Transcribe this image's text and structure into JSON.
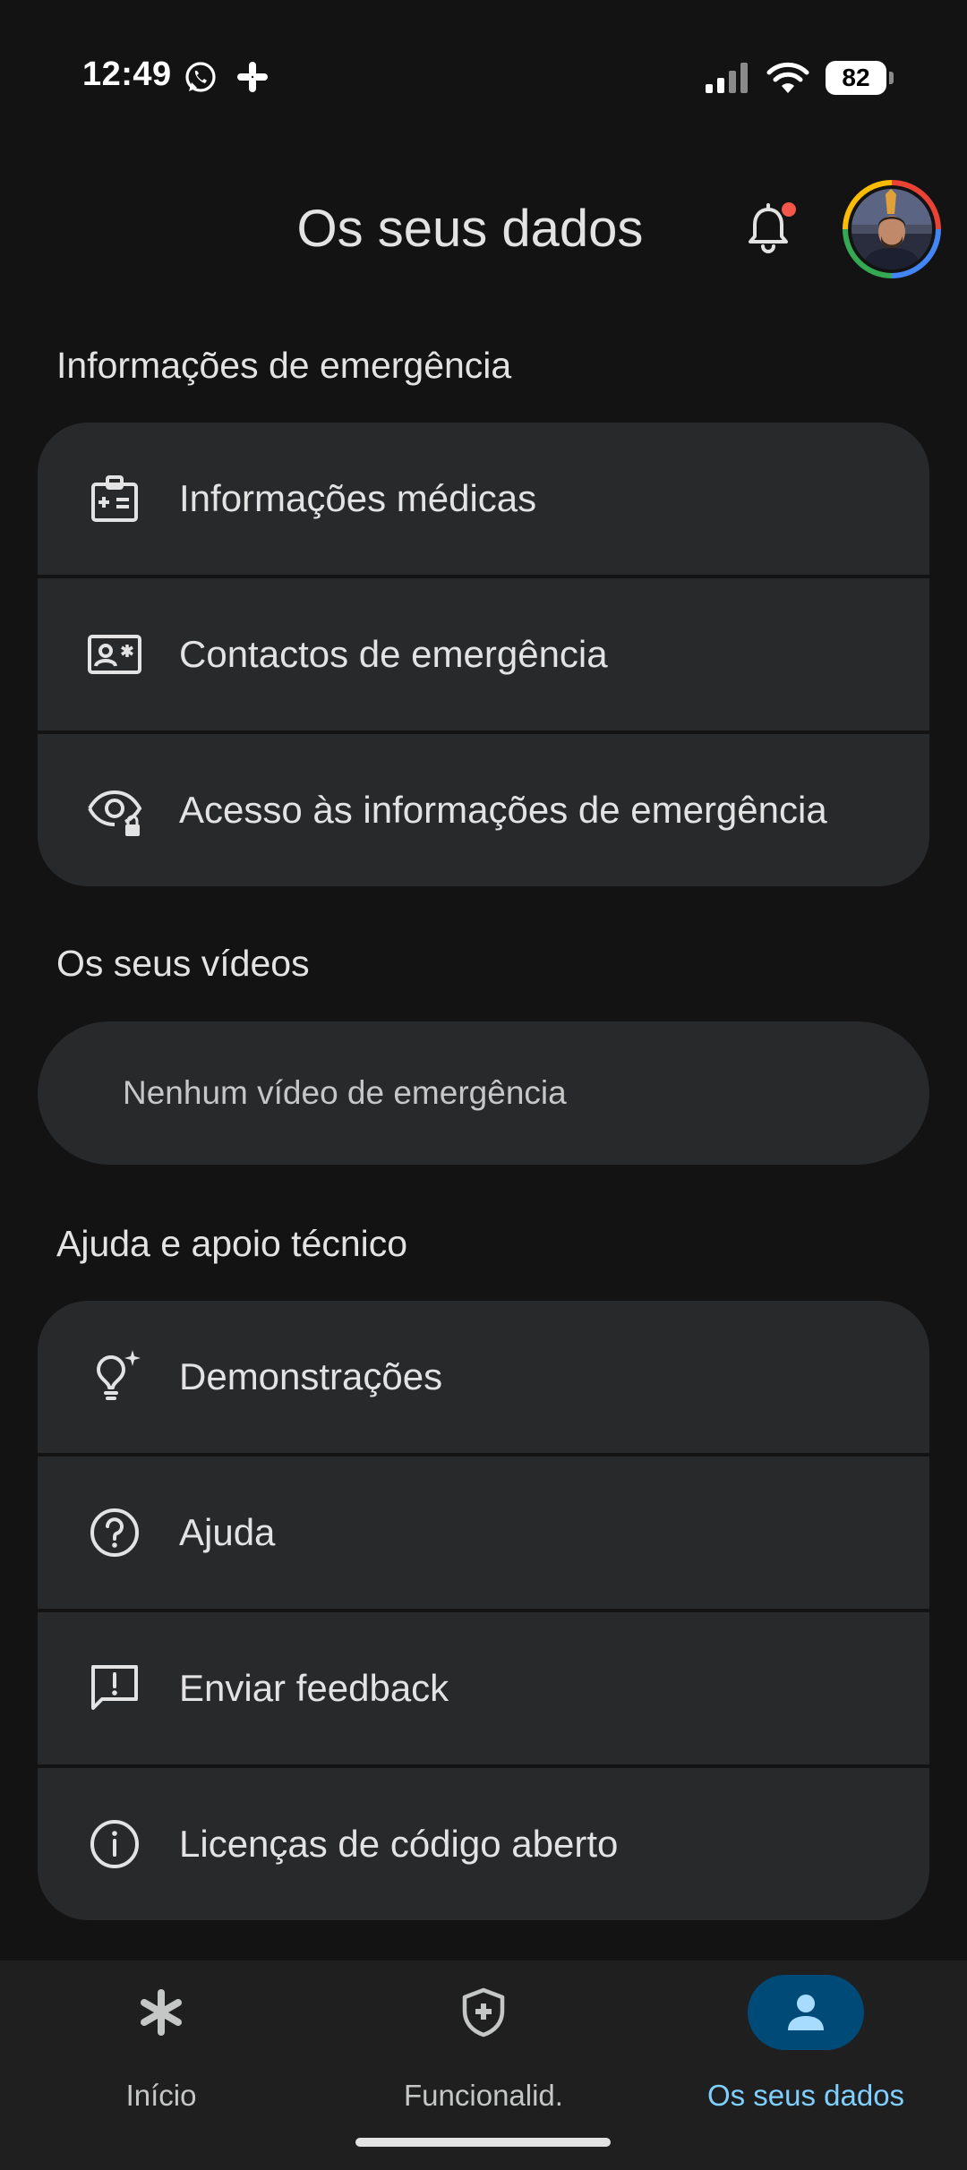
{
  "status_bar": {
    "time": "12:49",
    "battery": "82",
    "icons": [
      "whatsapp-icon",
      "slack-icon",
      "signal-icon",
      "wifi-icon",
      "battery-icon"
    ]
  },
  "header": {
    "title": "Os seus dados",
    "icons": [
      "bell-icon",
      "avatar"
    ],
    "notification_dot_color": "#f2574a"
  },
  "emergency_info": {
    "title": "Informações de emergência",
    "items": [
      {
        "label": "Informações médicas",
        "icon": "medical-id-icon"
      },
      {
        "label": "Contactos de emergência",
        "icon": "contact-card-icon"
      },
      {
        "label": "Acesso às informações de emergência",
        "icon": "eye-lock-icon"
      }
    ]
  },
  "videos": {
    "title": "Os seus vídeos",
    "empty_text": "Nenhum vídeo de emergência"
  },
  "help": {
    "title": "Ajuda e apoio técnico",
    "items": [
      {
        "label": "Demonstrações",
        "icon": "lightbulb-sparkle-icon"
      },
      {
        "label": "Ajuda",
        "icon": "help-circle-icon"
      },
      {
        "label": "Enviar feedback",
        "icon": "feedback-icon"
      },
      {
        "label": "Licenças de código aberto",
        "icon": "info-icon"
      }
    ]
  },
  "bottom_nav": {
    "items": [
      {
        "label": "Início",
        "icon": "asterisk-icon",
        "active": false
      },
      {
        "label": "Funcionalid.",
        "icon": "shield-plus-icon",
        "active": false
      },
      {
        "label": "Os seus dados",
        "icon": "person-icon",
        "active": true
      }
    ]
  },
  "colors": {
    "background": "#131314",
    "card": "#28292b",
    "accent": "#7fcfff",
    "active_pill": "#004a77"
  }
}
